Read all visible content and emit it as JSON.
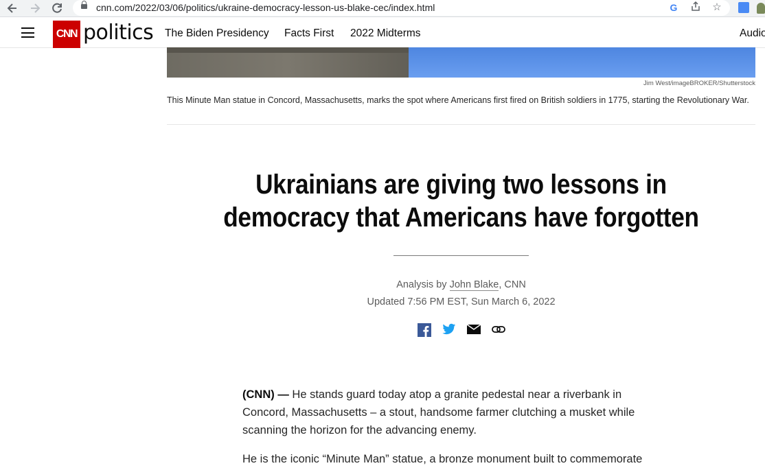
{
  "browser": {
    "url": "cnn.com/2022/03/06/politics/ukraine-democracy-lesson-us-blake-cec/index.html",
    "back_icon": "back-arrow-icon",
    "forward_icon": "forward-arrow-icon",
    "reload_icon": "reload-icon"
  },
  "header": {
    "logo_text": "CNN",
    "section_name": "politics",
    "nav": [
      "The Biden Presidency",
      "Facts First",
      "2022 Midterms",
      "Audio"
    ],
    "brand_color": "#cc0000"
  },
  "media": {
    "credit": "Jim West/imageBROKER/Shutterstock",
    "caption": "This Minute Man statue in Concord, Massachusetts, marks the spot where Americans first fired on British soldiers in 1775, starting the Revolutionary War."
  },
  "article": {
    "headline_line1": "Ukrainians are giving two lessons in",
    "headline_line2": "democracy that Americans have forgotten",
    "byline_prefix": "Analysis by",
    "author": "John Blake",
    "byline_suffix": ", CNN",
    "updated": "Updated 7:56 PM EST, Sun March 6, 2022",
    "dateline": "(CNN) —",
    "para1": " He stands guard today atop a granite pedestal near a riverbank in Concord, Massachusetts – a stout, handsome farmer clutching a musket while scanning the horizon for the advancing enemy.",
    "para2": "He is the iconic “Minute Man” statue, a bronze monument built to commemorate"
  },
  "share_icons": [
    "facebook-icon",
    "twitter-icon",
    "email-icon",
    "link-icon"
  ]
}
